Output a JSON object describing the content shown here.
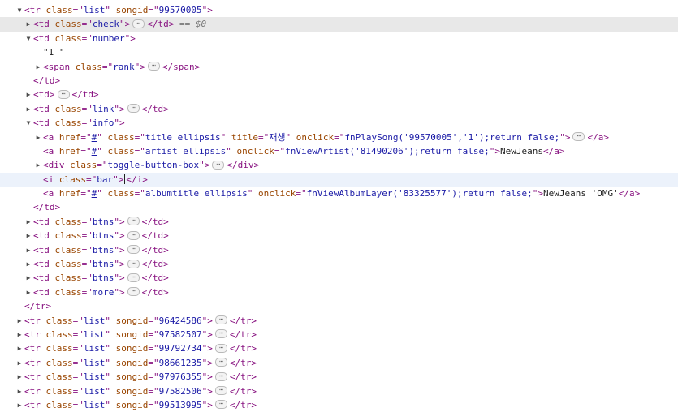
{
  "icons": {
    "expanded": "triangle-down-icon",
    "collapsed": "triangle-right-icon",
    "ellipsis": "ellipsis-icon"
  },
  "colors": {
    "tag": "#881280",
    "attr_name": "#994500",
    "attr_value": "#1a1aa6",
    "selected_row": "#e8e8e8",
    "hover_row": "#ecf2fb"
  },
  "dom": {
    "tr_open": "<tr class=\"list\" songid=\"99570005\">",
    "td_check": "<td class=\"check\">",
    "td_check_end": "</td>",
    "selected_marker": "== $0",
    "td_number_open": "<td class=\"number\">",
    "number_text": "\"1 \"",
    "span_rank": "<span class=\"rank\">",
    "span_close": "</span>",
    "td_close": "</td>",
    "td_empty_open": "<td>",
    "td_link": "<td class=\"link\">",
    "td_info_open": "<td class=\"info\">",
    "a_title_open": "<a href=\"#\" class=\"title ellipsis\" title=\"재생\" onclick=\"fnPlaySong('99570005','1');return false;\">",
    "a_close": "</a>",
    "a_artist_open": "<a href=\"#\" class=\"artist ellipsis\" onclick=\"fnViewArtist('81490206');return false;\">",
    "artist_name": "NewJeans",
    "div_toggle": "<div class=\"toggle-button-box\">",
    "div_close": "</div>",
    "i_bar_open": "<i class=\"bar\">",
    "i_close": "</i>",
    "a_album_open": "<a href=\"#\" class=\"albumtitle ellipsis\" onclick=\"fnViewAlbumLayer('83325577');return false;\">",
    "album_title": "NewJeans 'OMG'",
    "td_btns": "<td class=\"btns\">",
    "td_more": "<td class=\"more\">",
    "tr_close": "</tr>"
  },
  "collapsed_rows": [
    {
      "open": "<tr class=\"list\" songid=\"96424586\">",
      "close": "</tr>"
    },
    {
      "open": "<tr class=\"list\" songid=\"97582507\">",
      "close": "</tr>"
    },
    {
      "open": "<tr class=\"list\" songid=\"99792734\">",
      "close": "</tr>"
    },
    {
      "open": "<tr class=\"list\" songid=\"98661235\">",
      "close": "</tr>"
    },
    {
      "open": "<tr class=\"list\" songid=\"97976355\">",
      "close": "</tr>"
    },
    {
      "open": "<tr class=\"list\" songid=\"97582506\">",
      "close": "</tr>"
    },
    {
      "open": "<tr class=\"list\" songid=\"99513995\">",
      "close": "</tr>"
    }
  ]
}
